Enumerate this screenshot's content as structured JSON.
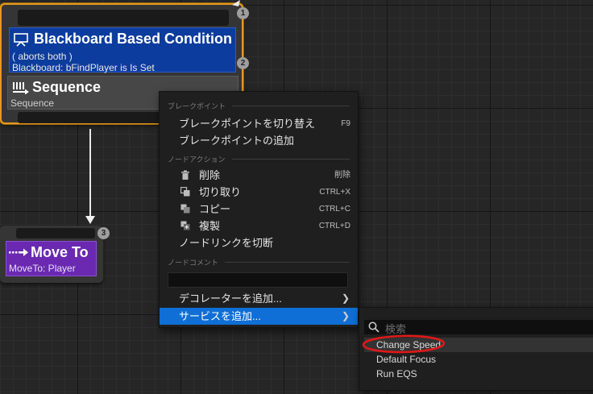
{
  "nodes": {
    "sequence": {
      "decorator_title": "Blackboard Based Condition",
      "decorator_line1": "( aborts both )",
      "decorator_line2": "Blackboard: bFindPlayer is Is Set",
      "title": "Sequence",
      "subtitle": "Sequence",
      "badge_top": "1",
      "badge_decorator": "2"
    },
    "move_to": {
      "title": "Move To",
      "subtitle": "MoveTo: Player",
      "badge": "3"
    }
  },
  "context_menu": {
    "section_breakpoint": "ブレークポイント",
    "toggle_breakpoint": "ブレークポイントを切り替え",
    "toggle_breakpoint_shortcut": "F9",
    "add_breakpoint": "ブレークポイントの追加",
    "section_node_actions": "ノードアクション",
    "delete": "削除",
    "delete_shortcut": "削除",
    "cut": "切り取り",
    "cut_shortcut": "CTRL+X",
    "copy": "コピー",
    "copy_shortcut": "CTRL+C",
    "duplicate": "複製",
    "duplicate_shortcut": "CTRL+D",
    "break_links": "ノードリンクを切断",
    "section_node_comment": "ノードコメント",
    "add_decorator": "デコレーターを追加...",
    "add_service": "サービスを追加..."
  },
  "submenu": {
    "search_placeholder": "検索",
    "items": [
      "Change Speed",
      "Default Focus",
      "Run EQS"
    ]
  },
  "colors": {
    "selection_outline": "#e29a1d",
    "decorator_blue": "#0c3c9e",
    "task_purple": "#6a29b0",
    "menu_highlight": "#0f6fd6",
    "annotation_red": "#e01818"
  }
}
